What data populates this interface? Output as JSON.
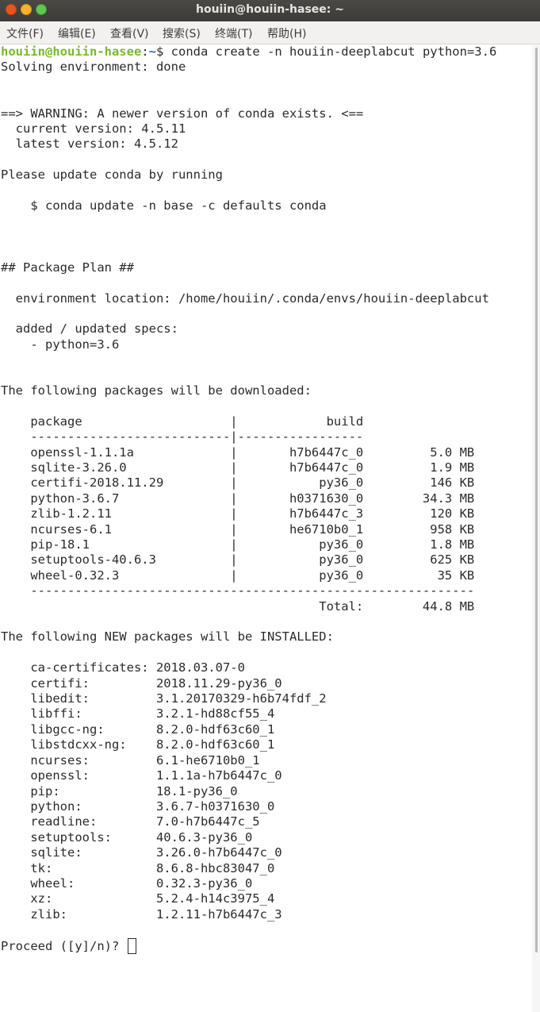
{
  "window": {
    "title": "houiin@houiin-hasee: ~"
  },
  "menu": {
    "file": "文件(F)",
    "edit": "编辑(E)",
    "view": "查看(V)",
    "search": "搜索(S)",
    "terminal": "终端(T)",
    "help": "帮助(H)"
  },
  "prompt": {
    "user_host": "houiin@houiin-hasee",
    "colon": ":",
    "path": "~",
    "symbol": "$",
    "command": " conda create -n houiin-deeplabcut python=3.6"
  },
  "output": {
    "solving": "Solving environment: done",
    "warning_line": "==> WARNING: A newer version of conda exists. <==",
    "current_version": "  current version: 4.5.11",
    "latest_version": "  latest version: 4.5.12",
    "please_update": "Please update conda by running",
    "update_cmd": "    $ conda update -n base -c defaults conda",
    "plan_header": "## Package Plan ##",
    "env_location": "  environment location: /home/houiin/.conda/envs/houiin-deeplabcut",
    "specs_header": "  added / updated specs:",
    "spec_item": "    - python=3.6",
    "download_header": "The following packages will be downloaded:",
    "table_header": "    package                    |            build",
    "table_sep": "    ---------------------------|-----------------",
    "download_rows": [
      "    openssl-1.1.1a             |       h7b6447c_0         5.0 MB",
      "    sqlite-3.26.0              |       h7b6447c_0         1.9 MB",
      "    certifi-2018.11.29         |           py36_0         146 KB",
      "    python-3.6.7               |       h0371630_0        34.3 MB",
      "    zlib-1.2.11                |       h7b6447c_3         120 KB",
      "    ncurses-6.1                |       he6710b0_1         958 KB",
      "    pip-18.1                   |           py36_0         1.8 MB",
      "    setuptools-40.6.3          |           py36_0         625 KB",
      "    wheel-0.32.3               |           py36_0          35 KB"
    ],
    "total_sep": "    ------------------------------------------------------------",
    "total_line": "                                           Total:        44.8 MB",
    "new_header": "The following NEW packages will be INSTALLED:",
    "new_rows": [
      "    ca-certificates: 2018.03.07-0",
      "    certifi:         2018.11.29-py36_0",
      "    libedit:         3.1.20170329-h6b74fdf_2",
      "    libffi:          3.2.1-hd88cf55_4",
      "    libgcc-ng:       8.2.0-hdf63c60_1",
      "    libstdcxx-ng:    8.2.0-hdf63c60_1",
      "    ncurses:         6.1-he6710b0_1",
      "    openssl:         1.1.1a-h7b6447c_0",
      "    pip:             18.1-py36_0",
      "    python:          3.6.7-h0371630_0",
      "    readline:        7.0-h7b6447c_5",
      "    setuptools:      40.6.3-py36_0",
      "    sqlite:          3.26.0-h7b6447c_0",
      "    tk:              8.6.8-hbc83047_0",
      "    wheel:           0.32.3-py36_0",
      "    xz:              5.2.4-h14c3975_4",
      "    zlib:            1.2.11-h7b6447c_3"
    ],
    "proceed": "Proceed ([y]/n)? "
  }
}
